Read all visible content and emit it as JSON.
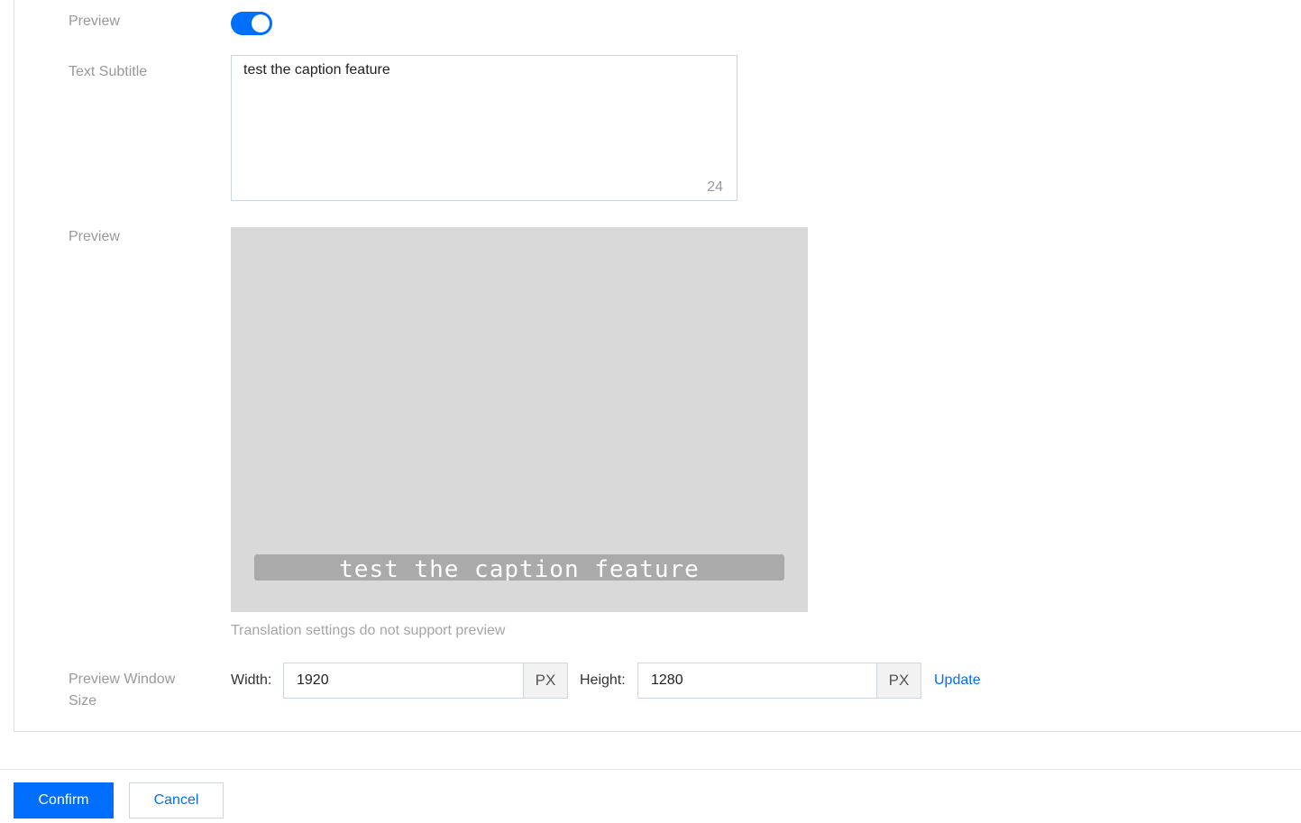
{
  "form": {
    "preview_toggle_label": "Preview",
    "preview_toggle_on": true,
    "text_subtitle_label": "Text Subtitle",
    "text_subtitle_value": "test the caption feature",
    "text_subtitle_count": "24",
    "preview_label": "Preview",
    "preview_caption": "test the caption feature",
    "preview_hint": "Translation settings do not support preview",
    "window_size_label_line1": "Preview Window",
    "window_size_label_line2": "Size",
    "width_label": "Width:",
    "width_value": "1920",
    "width_unit": "PX",
    "height_label": "Height:",
    "height_value": "1280",
    "height_unit": "PX",
    "update_link": "Update"
  },
  "footer": {
    "confirm_label": "Confirm",
    "cancel_label": "Cancel"
  },
  "colors": {
    "accent": "#006eff",
    "preview_bg": "#d9d9d9",
    "caption_bar": "#aaaaaa"
  }
}
